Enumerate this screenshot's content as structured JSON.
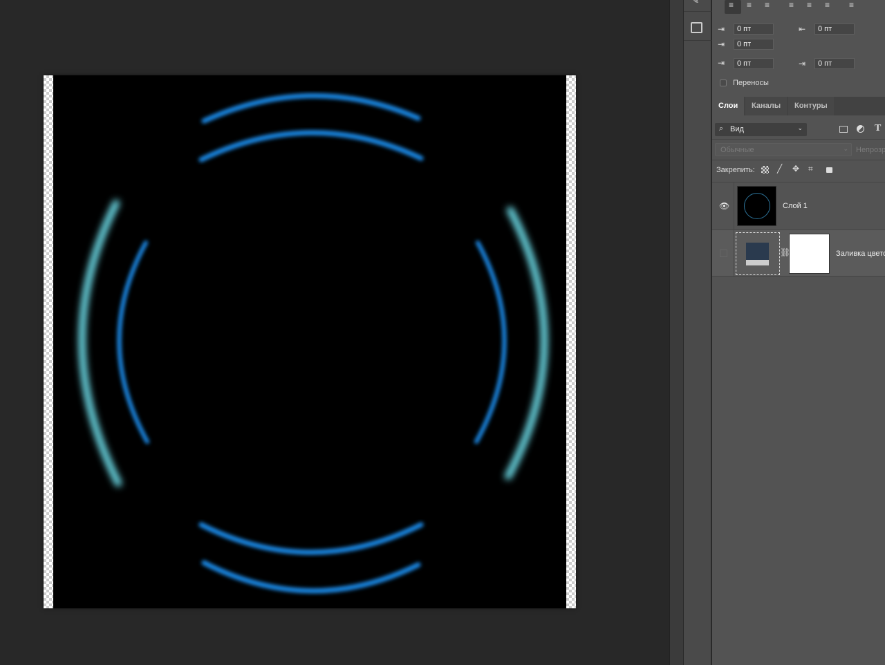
{
  "paragraph": {
    "indent_left": "0 пт",
    "indent_right": "0 пт",
    "indent_first": "0 пт",
    "space_before": "0 пт",
    "space_after": "0 пт",
    "hyphenate_label": "Переносы",
    "hyphenate_checked": false
  },
  "layers_panel": {
    "tabs": [
      {
        "label": "Слои",
        "active": true
      },
      {
        "label": "Каналы"
      },
      {
        "label": "Контуры"
      }
    ],
    "filter_label": "Вид",
    "blend_mode": "Обычные",
    "opacity_label": "Непрозр",
    "lock_label": "Закрепить:",
    "layers": [
      {
        "name": "Слой 1",
        "visible": true
      },
      {
        "name": "Заливка цвето",
        "visible": false
      }
    ]
  },
  "colors": {
    "arc_blue": "#1e8ff0",
    "arc_cyan": "#6fe3f0",
    "canvas_bg": "#000000"
  }
}
